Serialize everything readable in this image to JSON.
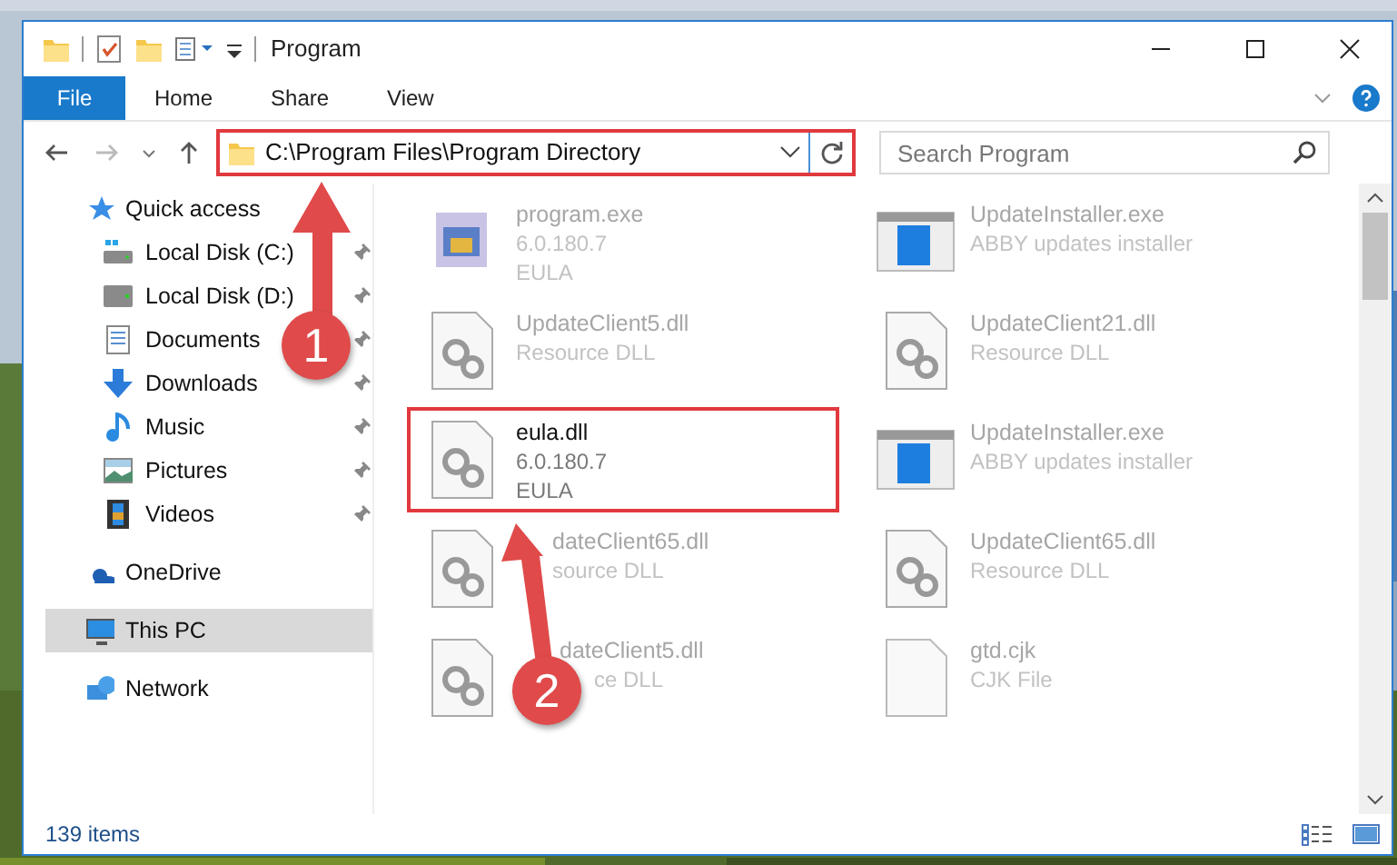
{
  "window": {
    "title": "Program"
  },
  "ribbon_tabs": [
    {
      "label": "File",
      "selected": true
    },
    {
      "label": "Home",
      "selected": false
    },
    {
      "label": "Share",
      "selected": false
    },
    {
      "label": "View",
      "selected": false
    }
  ],
  "address_bar": {
    "value": "C:\\Program Files\\Program Directory",
    "highlighted": true
  },
  "search": {
    "placeholder": "Search Program"
  },
  "navigation": [
    {
      "label": "Quick access",
      "selected": false,
      "children": [
        {
          "label": "Local Disk (C:)",
          "pinned": true
        },
        {
          "label": "Local Disk (D:)",
          "pinned": true
        },
        {
          "label": "Documents",
          "pinned": true
        },
        {
          "label": "Downloads",
          "pinned": true
        },
        {
          "label": "Music",
          "pinned": true
        },
        {
          "label": "Pictures",
          "pinned": true
        },
        {
          "label": "Videos",
          "pinned": true
        }
      ]
    },
    {
      "label": "OneDrive",
      "selected": false
    },
    {
      "label": "This PC",
      "selected": true
    },
    {
      "label": "Network",
      "selected": false
    }
  ],
  "files": [
    {
      "kind": "exe",
      "name": "program.exe",
      "lines": [
        "6.0.180.7",
        "EULA"
      ],
      "highlighted": false
    },
    {
      "kind": "installer",
      "name": "UpdateInstaller.exe",
      "lines": [
        "ABBY updates installer"
      ],
      "highlighted": false
    },
    {
      "kind": "dll",
      "name": "UpdateClient5.dll",
      "lines": [
        "Resource DLL"
      ],
      "highlighted": false
    },
    {
      "kind": "dll",
      "name": "UpdateClient21.dll",
      "lines": [
        "Resource DLL"
      ],
      "highlighted": false
    },
    {
      "kind": "dll",
      "name": "eula.dll",
      "lines": [
        "6.0.180.7",
        "EULA"
      ],
      "highlighted": true
    },
    {
      "kind": "installer",
      "name": "UpdateInstaller.exe",
      "lines": [
        "ABBY updates installer"
      ],
      "highlighted": false
    },
    {
      "kind": "dll",
      "name": "dateClient65.dll",
      "lines": [
        "source DLL"
      ],
      "highlighted": false
    },
    {
      "kind": "dll",
      "name": "UpdateClient65.dll",
      "lines": [
        "Resource DLL"
      ],
      "highlighted": false
    },
    {
      "kind": "dll",
      "name": "dateClient5.dll",
      "lines": [
        "ce DLL"
      ],
      "highlighted": false
    },
    {
      "kind": "file",
      "name": "gtd.cjk",
      "lines": [
        "CJK File"
      ],
      "highlighted": false
    }
  ],
  "status_bar": {
    "item_count": "139 items"
  },
  "callouts": [
    {
      "number": "1"
    },
    {
      "number": "2"
    }
  ]
}
